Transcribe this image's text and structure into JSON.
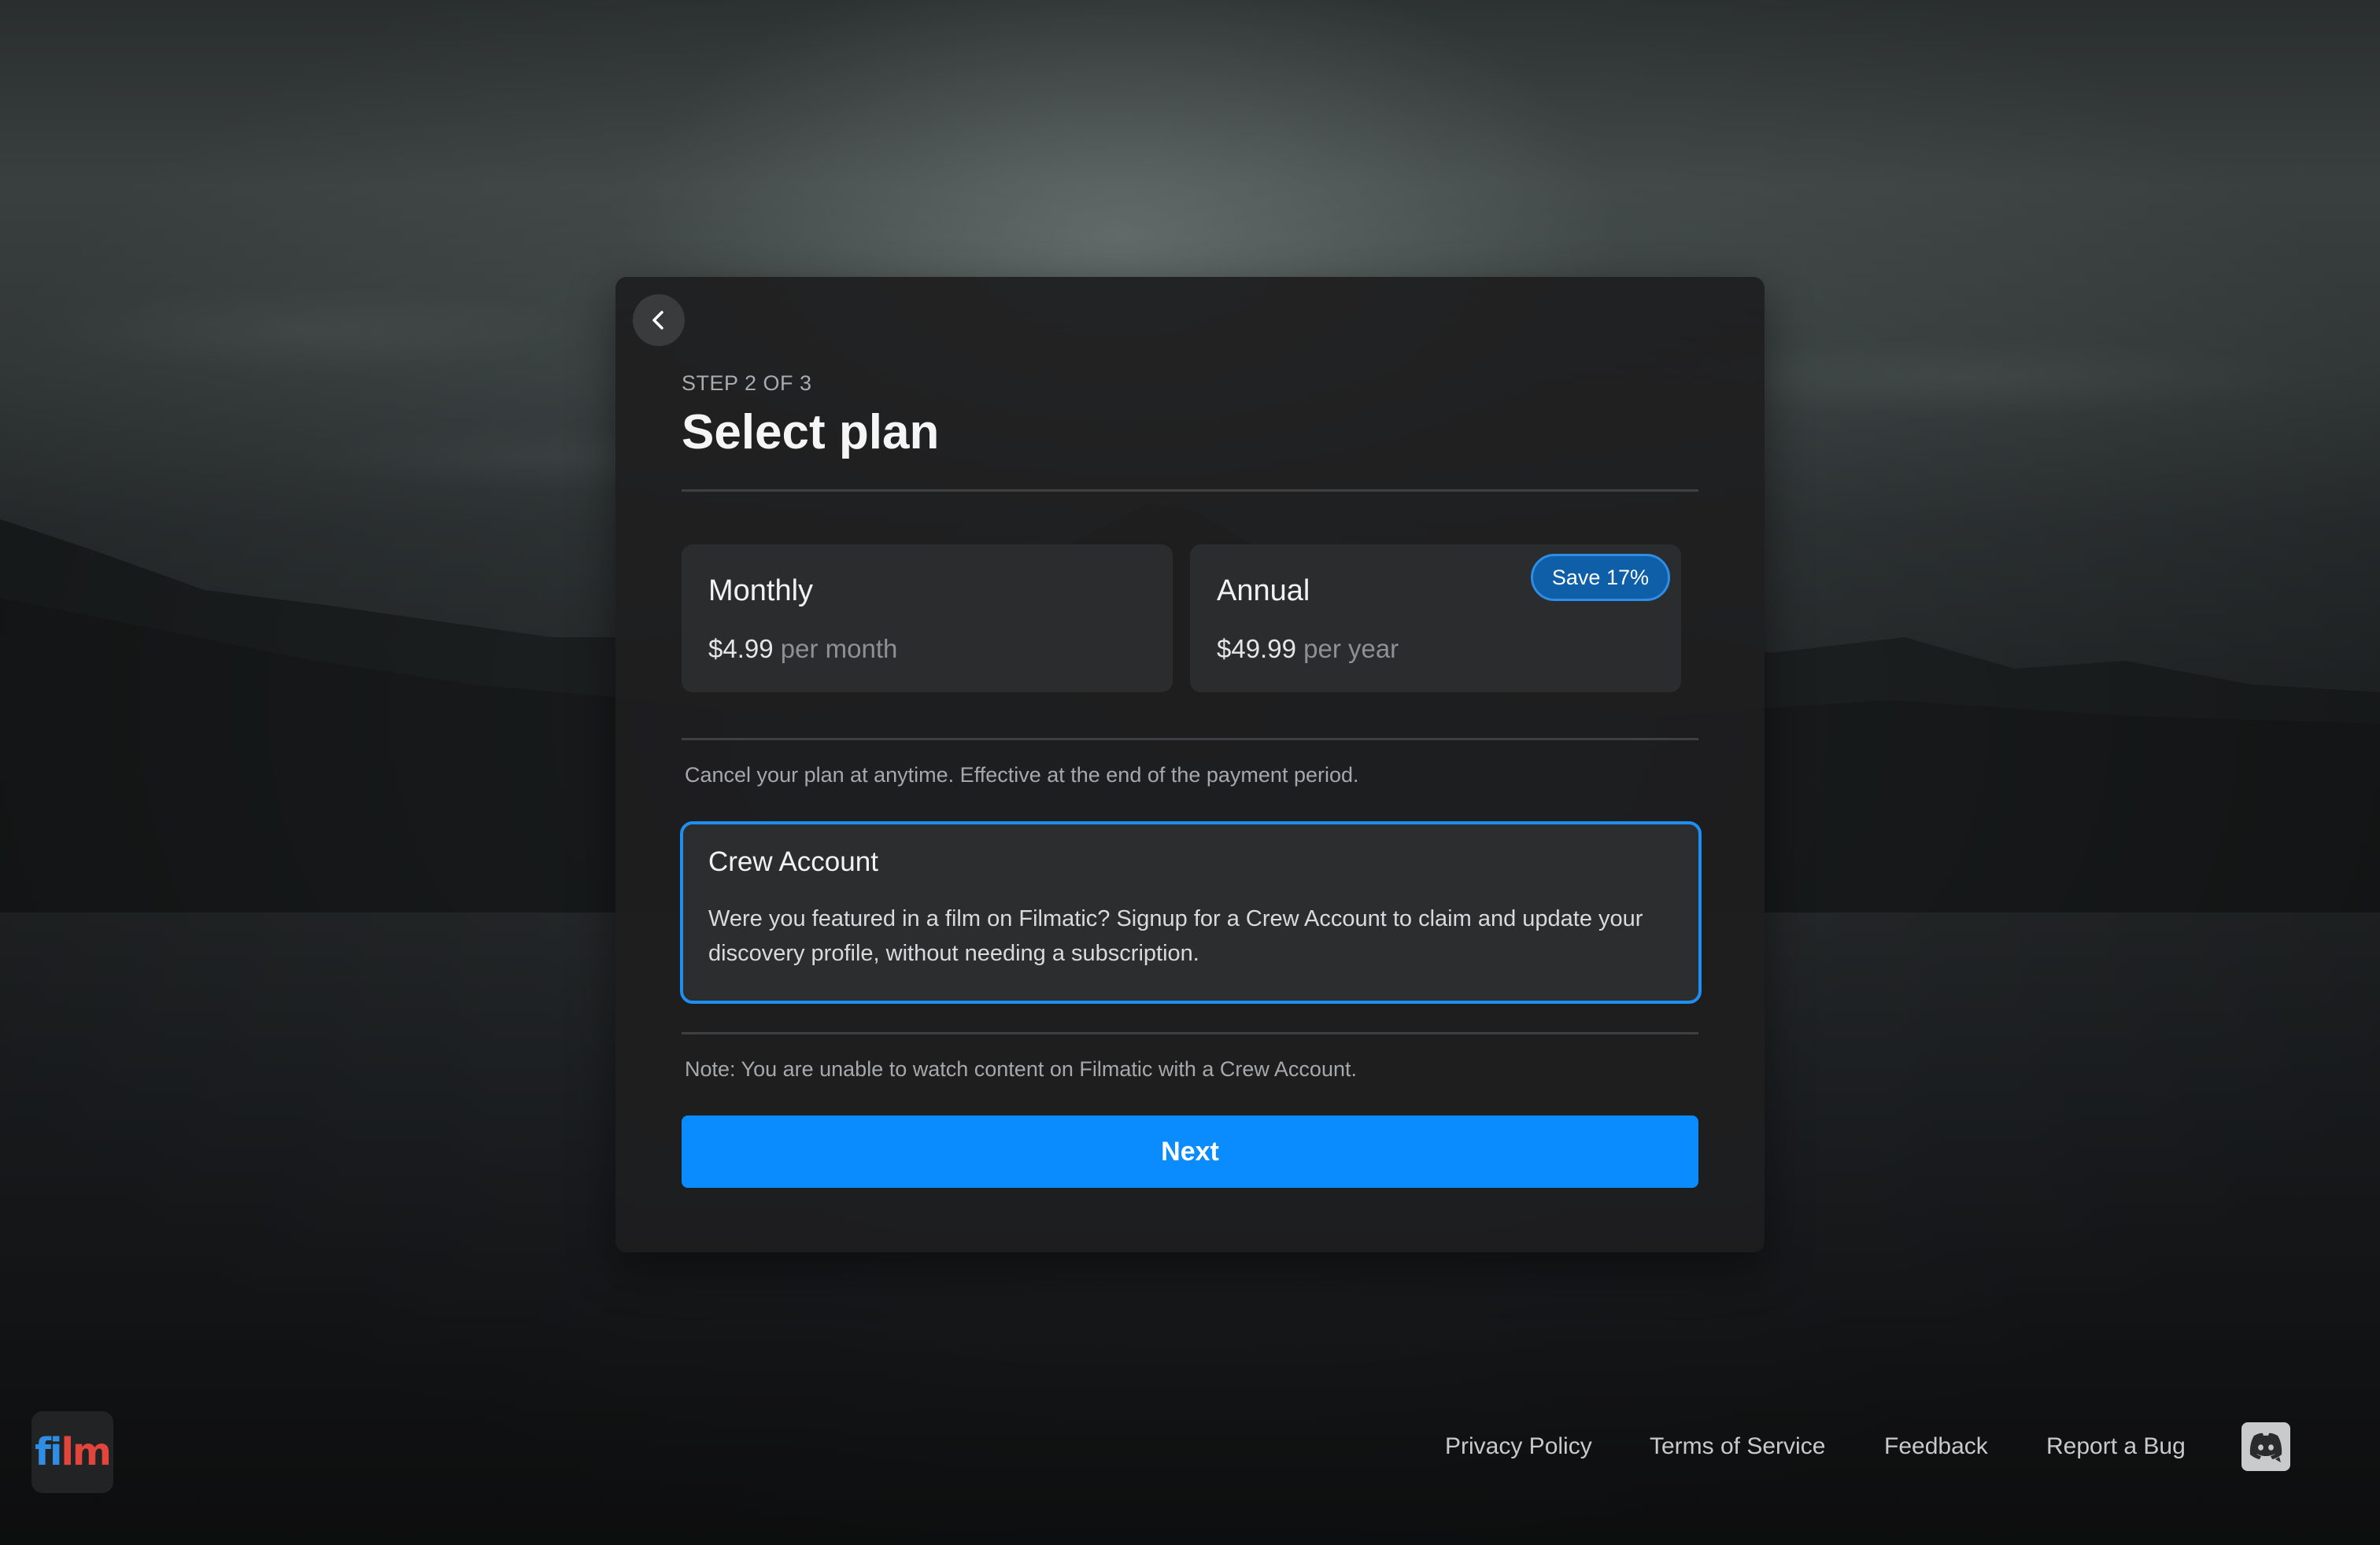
{
  "modal": {
    "step_label": "STEP 2 OF 3",
    "title": "Select plan",
    "plans": [
      {
        "name": "Monthly",
        "price": "$4.99",
        "period": "per month"
      },
      {
        "name": "Annual",
        "price": "$49.99",
        "period": "per year",
        "badge": "Save 17%"
      }
    ],
    "cancel_note": "Cancel your plan at anytime. Effective at the end of the payment period.",
    "crew": {
      "title": "Crew Account",
      "description": "Were you featured in a film on Filmatic? Signup for a Crew Account to claim and update your discovery profile, without needing a subscription."
    },
    "crew_note": "Note: You are unable to watch content on Filmatic with a Crew Account.",
    "next_label": "Next"
  },
  "footer": {
    "logo_part1": "fi",
    "logo_part2": "lm",
    "links": [
      "Privacy Policy",
      "Terms of Service",
      "Feedback",
      "Report a Bug"
    ]
  },
  "colors": {
    "accent": "#0a8cff",
    "selected_border": "#1e8ef0",
    "badge_bg": "#0f5fa8",
    "logo_blue": "#2f8de4",
    "logo_red": "#e2453c"
  },
  "icons": {
    "back": "chevron-left-icon",
    "discord": "discord-icon"
  }
}
